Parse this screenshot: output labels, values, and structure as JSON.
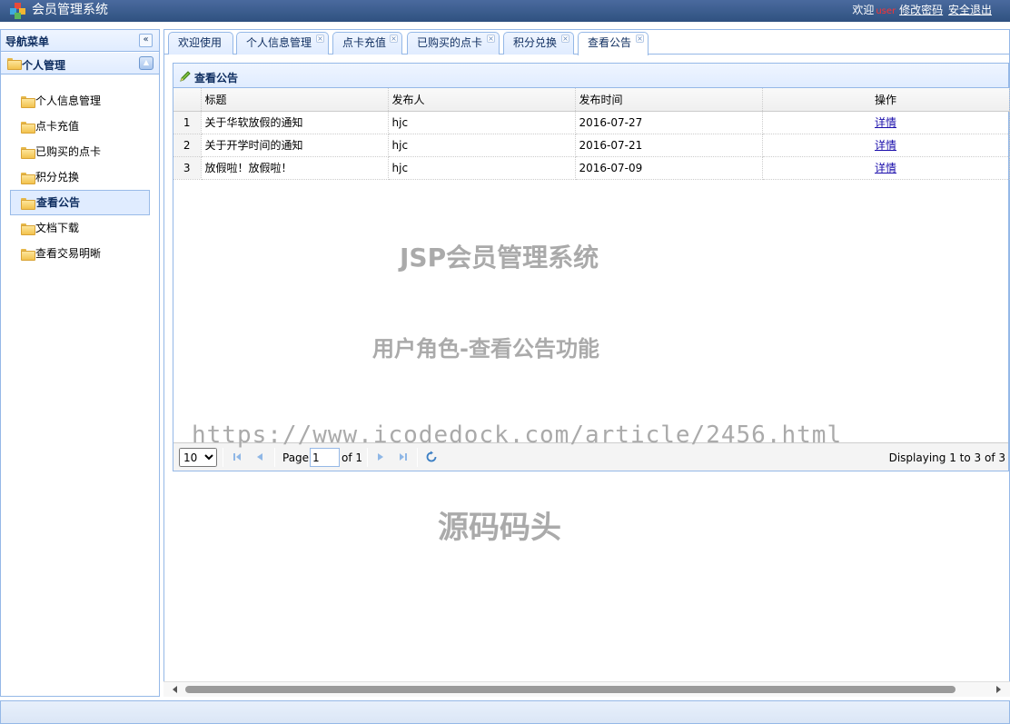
{
  "header": {
    "app_title": "会员管理系统",
    "welcome": "欢迎",
    "username": "user",
    "change_password": "修改密码",
    "logout": "安全退出"
  },
  "sidebar": {
    "title": "导航菜单",
    "collapse_icon": "double-chevron-left-icon",
    "group_title": "个人管理",
    "items": [
      {
        "label": "个人信息管理"
      },
      {
        "label": "点卡充值"
      },
      {
        "label": "已购买的点卡"
      },
      {
        "label": "积分兑换"
      },
      {
        "label": "查看公告",
        "active": true
      },
      {
        "label": "文档下载"
      },
      {
        "label": "查看交易明晰"
      }
    ]
  },
  "tabs": [
    {
      "label": "欢迎使用",
      "closable": false
    },
    {
      "label": "个人信息管理",
      "closable": true
    },
    {
      "label": "点卡充值",
      "closable": true
    },
    {
      "label": "已购买的点卡",
      "closable": true
    },
    {
      "label": "积分兑换",
      "closable": true
    },
    {
      "label": "查看公告",
      "closable": true,
      "active": true
    }
  ],
  "panel": {
    "title": "查看公告"
  },
  "table": {
    "columns": [
      "标题",
      "发布人",
      "发布时间",
      "操作"
    ],
    "rows": [
      {
        "no": "1",
        "title": "关于华软放假的通知",
        "publisher": "hjc",
        "date": "2016-07-27",
        "action": "详情"
      },
      {
        "no": "2",
        "title": "关于开学时间的通知",
        "publisher": "hjc",
        "date": "2016-07-21",
        "action": "详情"
      },
      {
        "no": "3",
        "title": "放假啦！放假啦！",
        "publisher": "hjc",
        "date": "2016-07-09",
        "action": "详情"
      }
    ]
  },
  "pager": {
    "page_size": "10",
    "page_label": "Page",
    "current_page": "1",
    "of_label": "of 1",
    "display_text": "Displaying 1 to 3 of 3"
  },
  "watermarks": {
    "line1": "JSP会员管理系统",
    "line2": "用户角色-查看公告功能",
    "line3": "https://www.icodedock.com/article/2456.html",
    "line4": "源码码头"
  },
  "colors": {
    "header_bg": "#2f5180",
    "panel_border": "#95b8e7",
    "panel_head_bg": "#e0ecff",
    "link": "#1a0dab"
  }
}
